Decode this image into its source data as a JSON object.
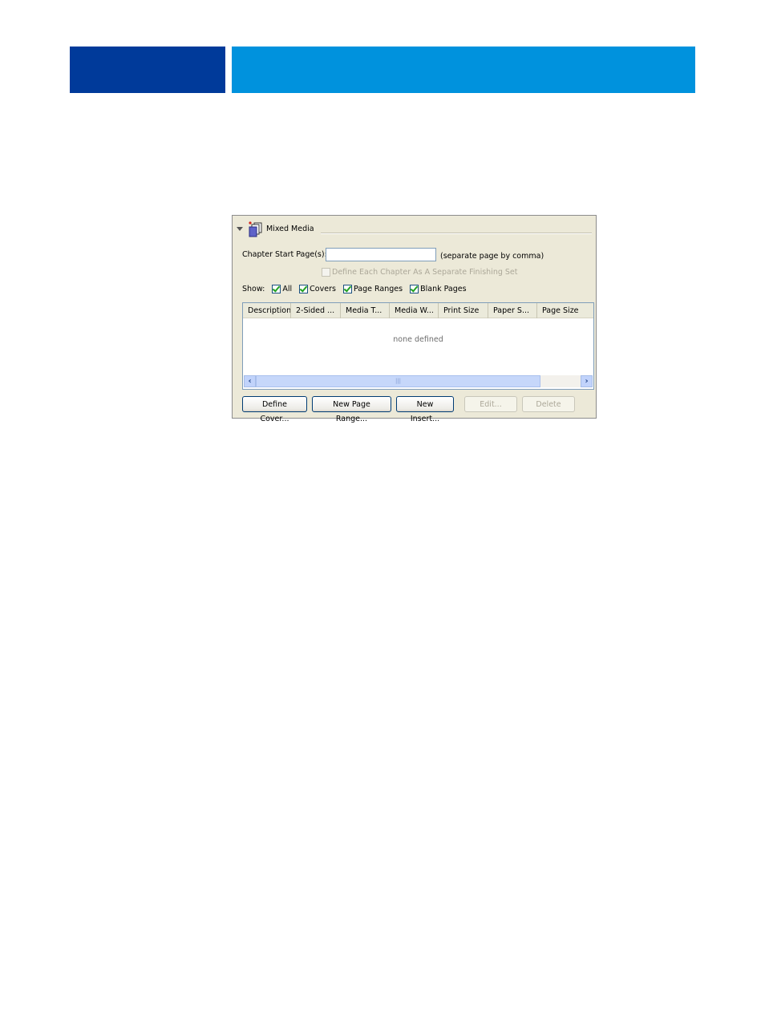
{
  "colors": {
    "header_dark": "#003a9a",
    "header_light": "#0092dd",
    "check": "#21a121"
  },
  "section": {
    "title": "Mixed Media",
    "icon": "mixed-media-icon"
  },
  "chapter": {
    "label": "Chapter Start Page(s):",
    "value": "",
    "note": "(separate page by comma)"
  },
  "define_each": {
    "label": "Define Each Chapter As A Separate Finishing Set",
    "checked": false,
    "enabled": false
  },
  "show": {
    "label": "Show:",
    "options": [
      {
        "label": "All",
        "checked": true
      },
      {
        "label": "Covers",
        "checked": true
      },
      {
        "label": "Page Ranges",
        "checked": true
      },
      {
        "label": "Blank Pages",
        "checked": true
      }
    ]
  },
  "table": {
    "columns": [
      "Description",
      "2-Sided ...",
      "Media T...",
      "Media W...",
      "Print Size",
      "Paper S...",
      "Page Size"
    ],
    "empty_text": "none defined"
  },
  "buttons": {
    "define_cover": "Define Cover...",
    "new_page_range": "New Page Range...",
    "new_insert": "New Insert...",
    "edit": "Edit...",
    "delete": "Delete"
  }
}
